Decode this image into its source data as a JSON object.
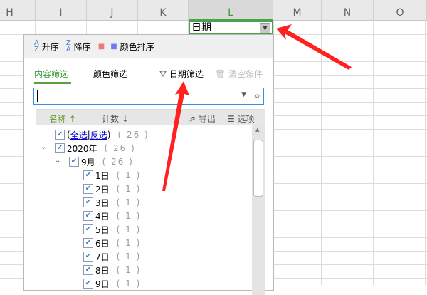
{
  "columns": [
    "H",
    "I",
    "J",
    "K",
    "L",
    "M",
    "N",
    "O"
  ],
  "cell_value": "日期",
  "sort": {
    "asc": "升序",
    "desc": "降序",
    "color": "颜色排序"
  },
  "tabs": {
    "content": "内容筛选",
    "color": "颜色筛选",
    "date": "日期筛选",
    "clear": "清空条件"
  },
  "search": {
    "value": ""
  },
  "list_header": {
    "name": "名称",
    "count": "计数",
    "export": "导出",
    "options": "选项"
  },
  "select_all": {
    "all": "全选",
    "invert": "反选",
    "count": "( 26 )"
  },
  "year": {
    "label": "2020年",
    "count": "( 26 )"
  },
  "month": {
    "label": "9月",
    "count": "( 26 )"
  },
  "days": [
    {
      "label": "1日",
      "count": "( 1 )"
    },
    {
      "label": "2日",
      "count": "( 1 )"
    },
    {
      "label": "3日",
      "count": "( 1 )"
    },
    {
      "label": "4日",
      "count": "( 1 )"
    },
    {
      "label": "5日",
      "count": "( 1 )"
    },
    {
      "label": "6日",
      "count": "( 1 )"
    },
    {
      "label": "7日",
      "count": "( 1 )"
    },
    {
      "label": "8日",
      "count": "( 1 )"
    },
    {
      "label": "9日",
      "count": "( 1 )"
    }
  ],
  "colors": {
    "accent": "#4ba24b",
    "arrow": "#ff2020"
  }
}
